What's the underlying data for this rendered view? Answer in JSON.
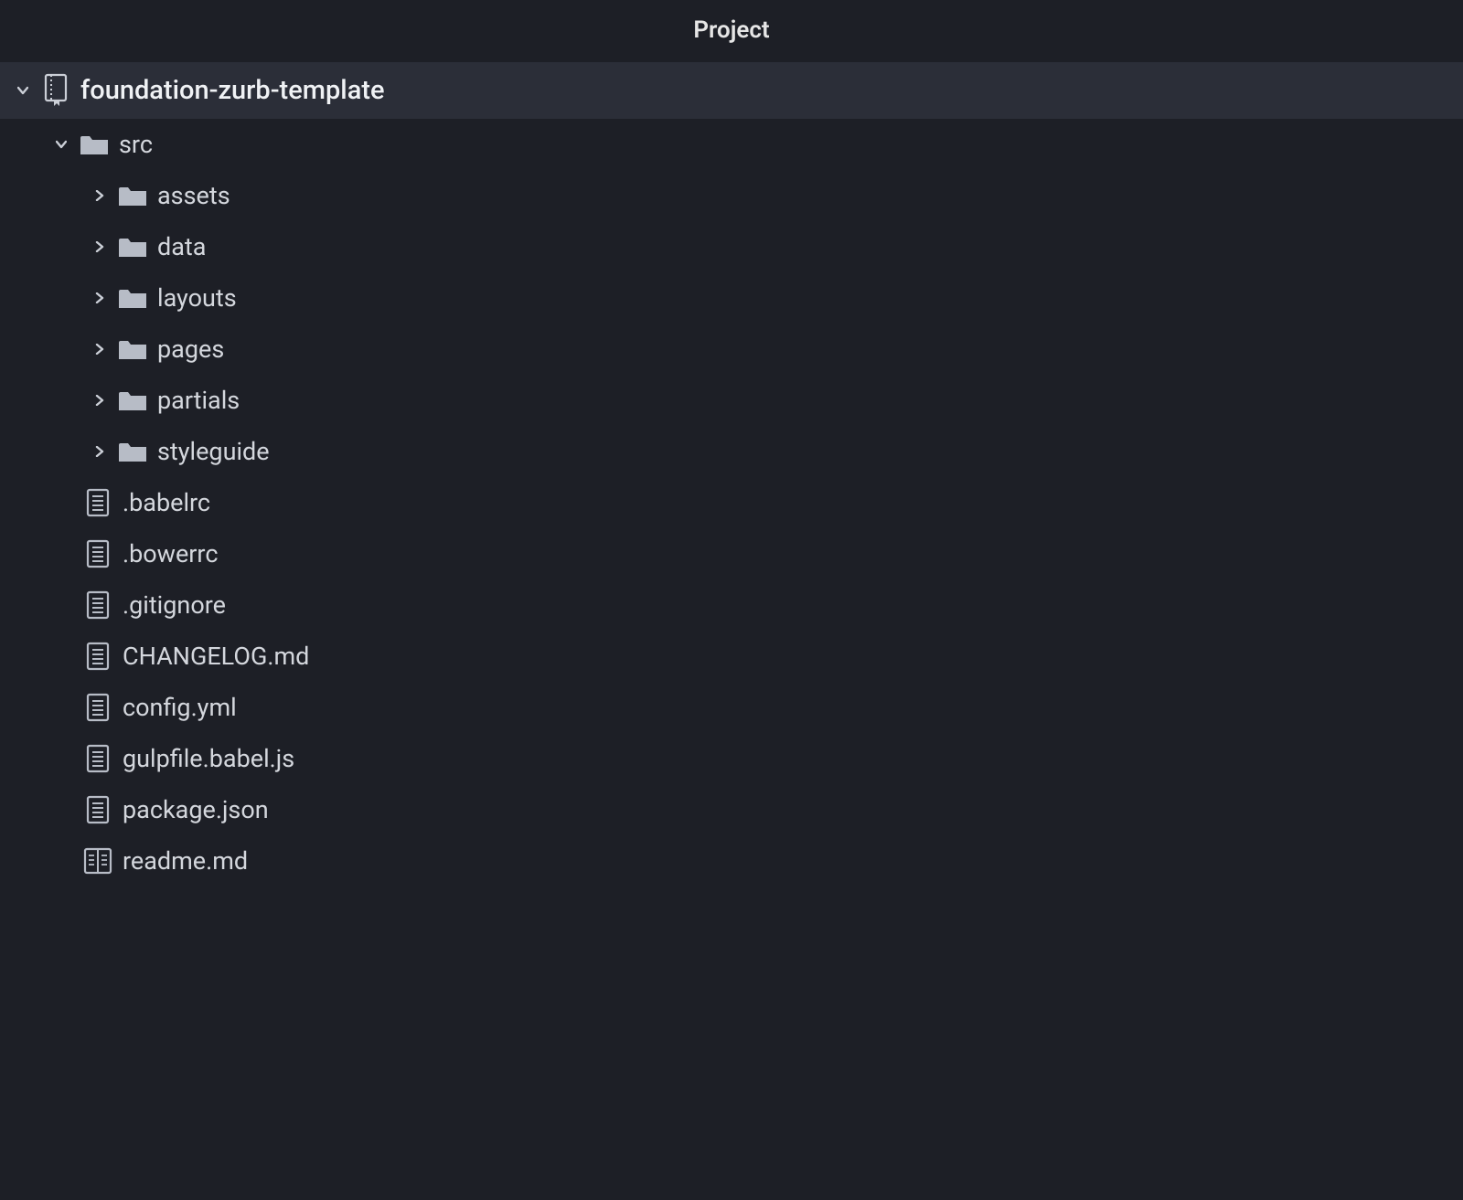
{
  "panel": {
    "title": "Project"
  },
  "root": {
    "name": "foundation-zurb-template"
  },
  "src": {
    "name": "src"
  },
  "folders": {
    "f0": {
      "name": "assets"
    },
    "f1": {
      "name": "data"
    },
    "f2": {
      "name": "layouts"
    },
    "f3": {
      "name": "pages"
    },
    "f4": {
      "name": "partials"
    },
    "f5": {
      "name": "styleguide"
    }
  },
  "files": {
    "i0": {
      "name": ".babelrc"
    },
    "i1": {
      "name": ".bowerrc"
    },
    "i2": {
      "name": ".gitignore"
    },
    "i3": {
      "name": "CHANGELOG.md"
    },
    "i4": {
      "name": "config.yml"
    },
    "i5": {
      "name": "gulpfile.babel.js"
    },
    "i6": {
      "name": "package.json"
    },
    "i7": {
      "name": "readme.md"
    }
  }
}
